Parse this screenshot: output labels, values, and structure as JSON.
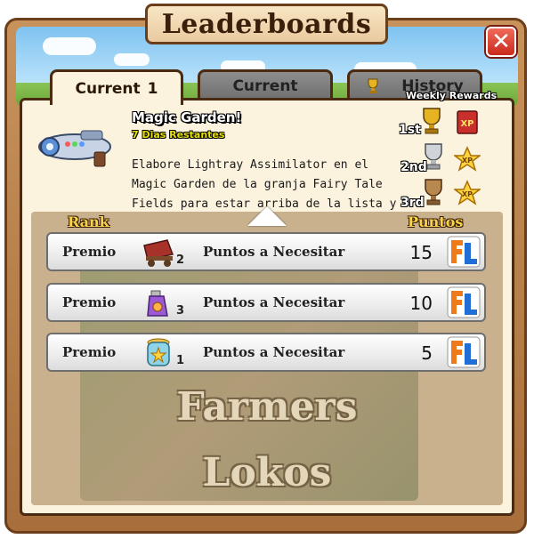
{
  "window": {
    "title": "Leaderboards",
    "close_label": "✕"
  },
  "tabs": [
    {
      "label": "Current",
      "badge": "1",
      "active": true
    },
    {
      "label": "Current",
      "active": false
    },
    {
      "label": "History",
      "active": false
    }
  ],
  "event": {
    "title": "Magic Garden!",
    "days_left": "7 Dias Restantes",
    "description": "Elabore Lightray Assimilator en el Magic Garden de la granja Fairy Tale Fields para estar arriba de la lista y ganar"
  },
  "weekly_rewards": {
    "title": "Weekly Rewards",
    "places": [
      {
        "label": "1st",
        "trophy": "gold-trophy",
        "reward": "xp-book"
      },
      {
        "label": "2nd",
        "trophy": "silver-trophy",
        "reward": "xp-star"
      },
      {
        "label": "3rd",
        "trophy": "bronze-trophy",
        "reward": "xp-star"
      }
    ]
  },
  "columns": {
    "rank": "Rank",
    "points": "Puntos"
  },
  "rows": [
    {
      "prize_label": "Premio",
      "item_icon": "wagon-icon",
      "qty": "2",
      "need_label": "Puntos a Necesitar",
      "points": "15"
    },
    {
      "prize_label": "Premio",
      "item_icon": "spray-bottle-icon",
      "qty": "3",
      "need_label": "Puntos a Necesitar",
      "points": "10"
    },
    {
      "prize_label": "Premio",
      "item_icon": "star-jar-icon",
      "qty": "1",
      "need_label": "Puntos a Necesitar",
      "points": "5"
    }
  ],
  "watermark": {
    "line1": "Farmers",
    "line2": "Lokos"
  },
  "colors": {
    "wood": "#a86e3c",
    "panel": "#fcf3df",
    "close": "#c92a1c",
    "header_gold": "#f8d24a"
  }
}
